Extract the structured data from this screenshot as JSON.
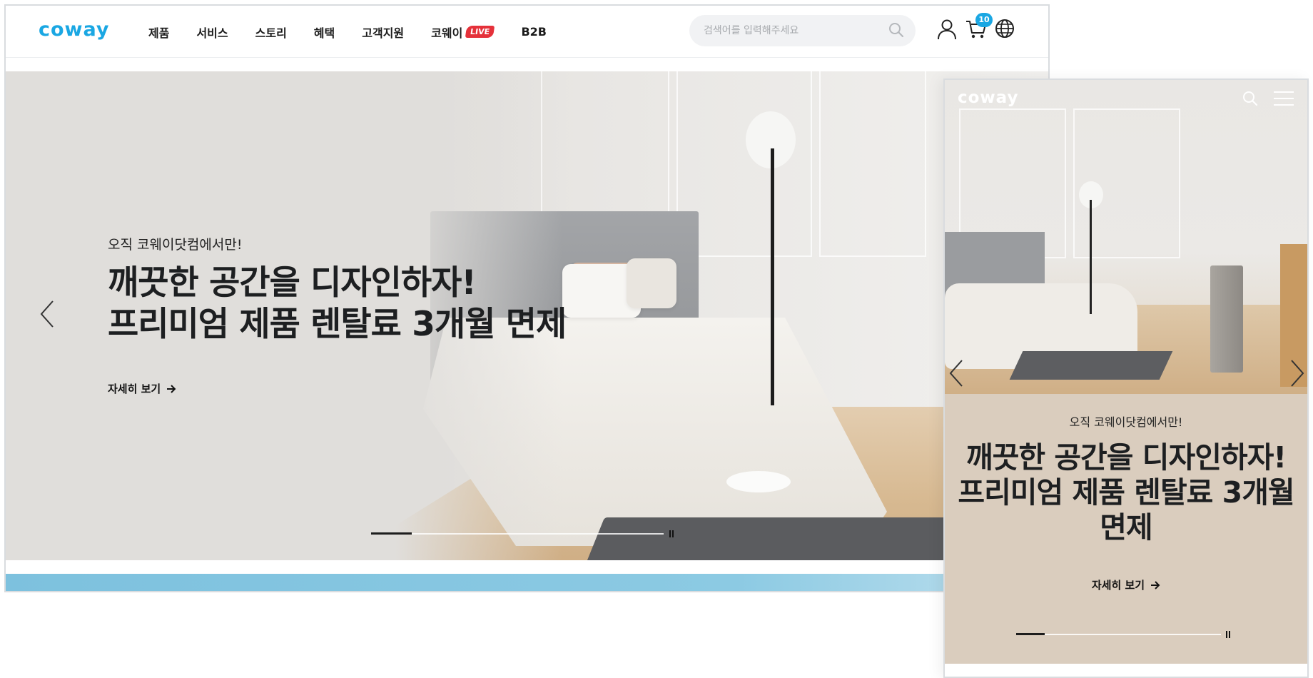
{
  "brand": {
    "logo_text": "coway",
    "accent_color": "#1aa7e3"
  },
  "desktop": {
    "nav": [
      {
        "label": "제품"
      },
      {
        "label": "서비스"
      },
      {
        "label": "스토리"
      },
      {
        "label": "혜택"
      },
      {
        "label": "고객지원"
      },
      {
        "label": "코웨이",
        "badge": "LIVE"
      },
      {
        "label": "B2B"
      }
    ],
    "search": {
      "placeholder": "검색어를 입력해주세요",
      "value": ""
    },
    "icons": {
      "user": "user-icon",
      "cart": "cart-icon",
      "language": "globe-icon"
    },
    "cart_count": "10",
    "hero": {
      "subtitle": "오직 코웨이닷컴에서만!",
      "title": "깨끗한 공간을 디자인하자!\n프리미엄 제품 렌탈료 3개월 면제",
      "cta": "자세히 보기",
      "progress": 0.14
    }
  },
  "mobile": {
    "hero": {
      "subtitle": "오직 코웨이닷컴에서만!",
      "title": "깨끗한 공간을 디자인하자!\n프리미엄 제품 렌탈료 3개월\n면제",
      "cta": "자세히 보기",
      "progress": 0.14
    },
    "icons": {
      "search": "search-icon",
      "menu": "hamburger-menu-icon"
    }
  },
  "colors": {
    "hero_background": "#e0dedb",
    "mobile_background": "#dacdbe",
    "live_badge": "#e5313a"
  }
}
